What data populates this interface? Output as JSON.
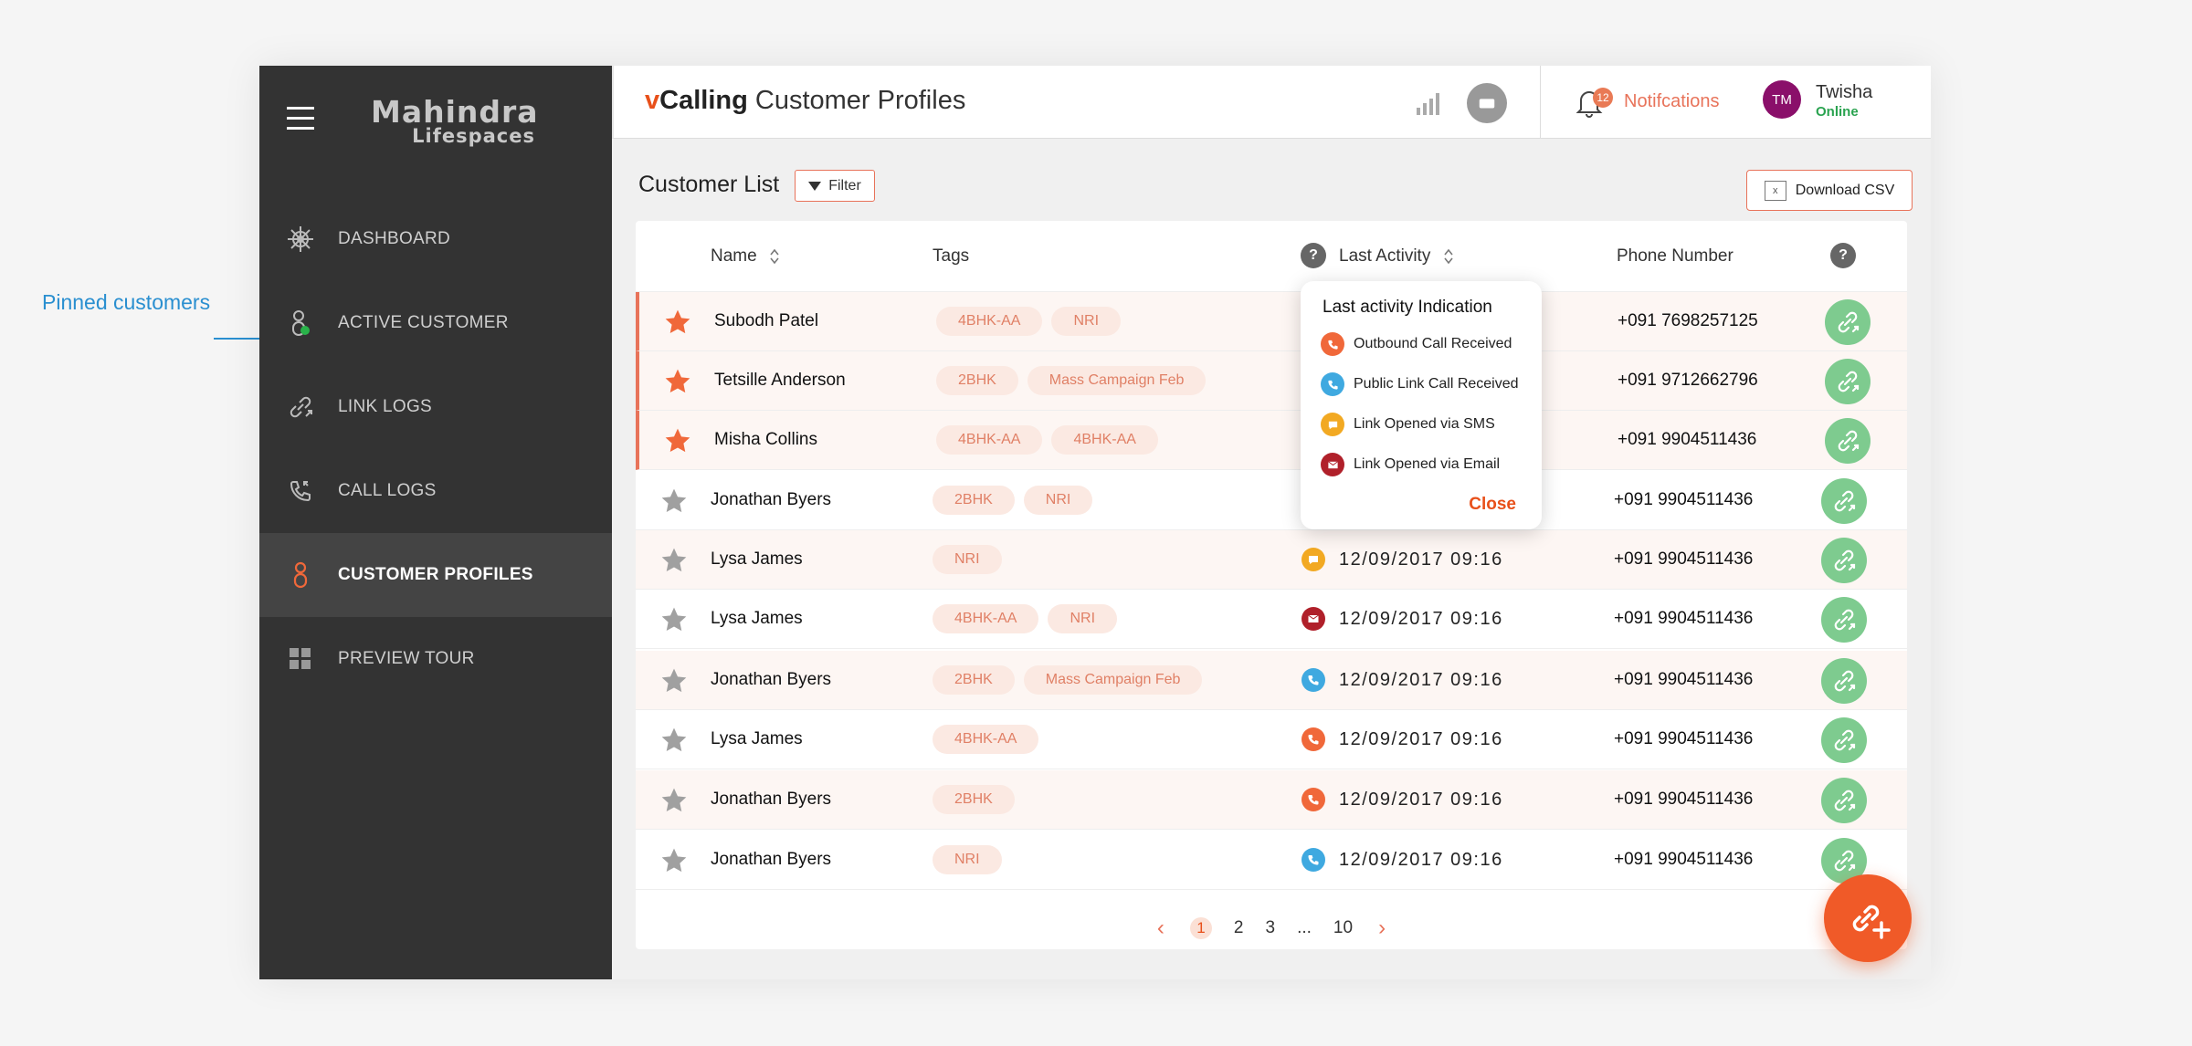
{
  "annotation": {
    "pinned_label": "Pinned customers"
  },
  "brand": {
    "line1": "Mahindra",
    "line2": "Lifespaces"
  },
  "sidebar": {
    "items": [
      {
        "label": "DASHBOARD",
        "icon": "helm-icon"
      },
      {
        "label": "ACTIVE CUSTOMER",
        "icon": "active-user-icon"
      },
      {
        "label": "LINK LOGS",
        "icon": "link-icon"
      },
      {
        "label": "CALL LOGS",
        "icon": "call-log-icon"
      },
      {
        "label": "CUSTOMER PROFILES",
        "icon": "profile-icon",
        "active": true
      },
      {
        "label": "PREVIEW TOUR",
        "icon": "grid-icon"
      }
    ]
  },
  "header": {
    "title_v": "v",
    "title_calling": "Calling",
    "title_rest": " Customer Profiles",
    "notifications_count": "12",
    "notifications_label": "Notifcations",
    "user_initials": "TM",
    "user_name": "Twisha",
    "user_status": "Online"
  },
  "main": {
    "list_title": "Customer List",
    "filter_label": "Filter",
    "download_label": "Download CSV",
    "columns": {
      "name": "Name",
      "tags": "Tags",
      "activity": "Last Activity",
      "phone": "Phone Number",
      "help": "?"
    },
    "rows": [
      {
        "name": "Subodh Patel",
        "tags": [
          "4BHK-AA",
          "NRI"
        ],
        "pinned": true,
        "activity": "",
        "time": "",
        "phone": "+091 7698257125"
      },
      {
        "name": "Tetsille Anderson",
        "tags": [
          "2BHK",
          "Mass Campaign Feb"
        ],
        "pinned": true,
        "activity": "",
        "time": "",
        "phone": "+091 9712662796"
      },
      {
        "name": "Misha Collins",
        "tags": [
          "4BHK-AA",
          "4BHK-AA"
        ],
        "pinned": true,
        "activity": "",
        "time": "",
        "phone": "+091 9904511436"
      },
      {
        "name": "Jonathan Byers",
        "tags": [
          "2BHK",
          "NRI"
        ],
        "pinned": false,
        "activity": "",
        "time": "",
        "phone": "+091 9904511436"
      },
      {
        "name": "Lysa James",
        "tags": [
          "NRI"
        ],
        "pinned": false,
        "activity": "sms",
        "time": "12/09/2017 09:16",
        "phone": "+091 9904511436"
      },
      {
        "name": "Lysa James",
        "tags": [
          "4BHK-AA",
          "NRI"
        ],
        "pinned": false,
        "activity": "email",
        "time": "12/09/2017 09:16",
        "phone": "+091 9904511436"
      },
      {
        "name": "Jonathan Byers",
        "tags": [
          "2BHK",
          "Mass Campaign Feb"
        ],
        "pinned": false,
        "activity": "public",
        "time": "12/09/2017 09:16",
        "phone": "+091 9904511436"
      },
      {
        "name": "Lysa James",
        "tags": [
          "4BHK-AA"
        ],
        "pinned": false,
        "activity": "outbound",
        "time": "12/09/2017 09:16",
        "phone": "+091 9904511436"
      },
      {
        "name": "Jonathan Byers",
        "tags": [
          "2BHK"
        ],
        "pinned": false,
        "activity": "outbound",
        "time": "12/09/2017 09:16",
        "phone": "+091 9904511436"
      },
      {
        "name": "Jonathan Byers",
        "tags": [
          "NRI"
        ],
        "pinned": false,
        "activity": "public",
        "time": "12/09/2017 09:16",
        "phone": "+091 9904511436"
      }
    ],
    "pagination": {
      "prev": "‹",
      "pages": [
        "1",
        "2",
        "3",
        "...",
        "10"
      ],
      "current": "1",
      "next": "›"
    }
  },
  "popover": {
    "title": "Last activity Indication",
    "items": [
      {
        "label": "Outbound Call Received",
        "kind": "outbound"
      },
      {
        "label": "Public Link Call Received",
        "kind": "public"
      },
      {
        "label": "Link Opened via SMS",
        "kind": "sms"
      },
      {
        "label": "Link Opened via Email",
        "kind": "email"
      }
    ],
    "close_label": "Close"
  },
  "colors": {
    "accent": "#f05a28",
    "outbound": "#f0683a",
    "public": "#3fa9e0",
    "sms": "#f2a922",
    "email": "#b0202a",
    "link_button": "#7ecb8f",
    "star_pinned": "#f0683a",
    "star_default": "#a0a0a0"
  }
}
